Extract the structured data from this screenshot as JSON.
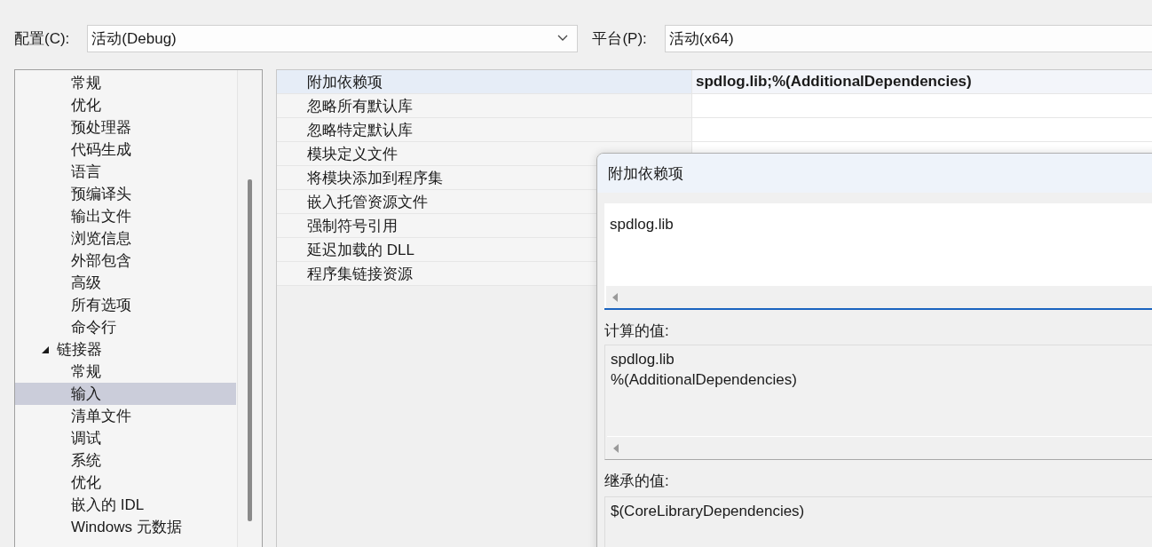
{
  "config": {
    "label": "配置(C):",
    "value": "活动(Debug)"
  },
  "platform": {
    "label": "平台(P):",
    "value": "活动(x64)"
  },
  "tree": {
    "items": [
      {
        "label": "常规",
        "selected": false
      },
      {
        "label": "优化",
        "selected": false
      },
      {
        "label": "预处理器",
        "selected": false
      },
      {
        "label": "代码生成",
        "selected": false
      },
      {
        "label": "语言",
        "selected": false
      },
      {
        "label": "预编译头",
        "selected": false
      },
      {
        "label": "输出文件",
        "selected": false
      },
      {
        "label": "浏览信息",
        "selected": false
      },
      {
        "label": "外部包含",
        "selected": false
      },
      {
        "label": "高级",
        "selected": false
      },
      {
        "label": "所有选项",
        "selected": false
      },
      {
        "label": "命令行",
        "selected": false
      },
      {
        "label": "链接器",
        "selected": false,
        "expanded": true,
        "children": [
          {
            "label": "常规",
            "selected": false
          },
          {
            "label": "输入",
            "selected": true
          },
          {
            "label": "清单文件",
            "selected": false
          },
          {
            "label": "调试",
            "selected": false
          },
          {
            "label": "系统",
            "selected": false
          },
          {
            "label": "优化",
            "selected": false
          },
          {
            "label": "嵌入的 IDL",
            "selected": false
          },
          {
            "label": "Windows 元数据",
            "selected": false
          }
        ]
      }
    ]
  },
  "properties": [
    {
      "name": "附加依赖项",
      "value": "spdlog.lib;%(AdditionalDependencies)",
      "selected": true
    },
    {
      "name": "忽略所有默认库",
      "selected": false
    },
    {
      "name": "忽略特定默认库",
      "selected": false
    },
    {
      "name": "模块定义文件",
      "selected": false
    },
    {
      "name": "将模块添加到程序集",
      "selected": false
    },
    {
      "name": "嵌入托管资源文件",
      "selected": false
    },
    {
      "name": "强制符号引用",
      "selected": false
    },
    {
      "name": "延迟加载的 DLL",
      "selected": false
    },
    {
      "name": "程序集链接资源",
      "selected": false
    }
  ],
  "dialog": {
    "title": "附加依赖项",
    "value": "spdlog.lib",
    "computed_label": "计算的值:",
    "computed_lines": [
      "spdlog.lib",
      "%(AdditionalDependencies)"
    ],
    "inherited_label": "继承的值:",
    "inherited_lines": [
      "$(CoreLibraryDependencies)"
    ]
  }
}
